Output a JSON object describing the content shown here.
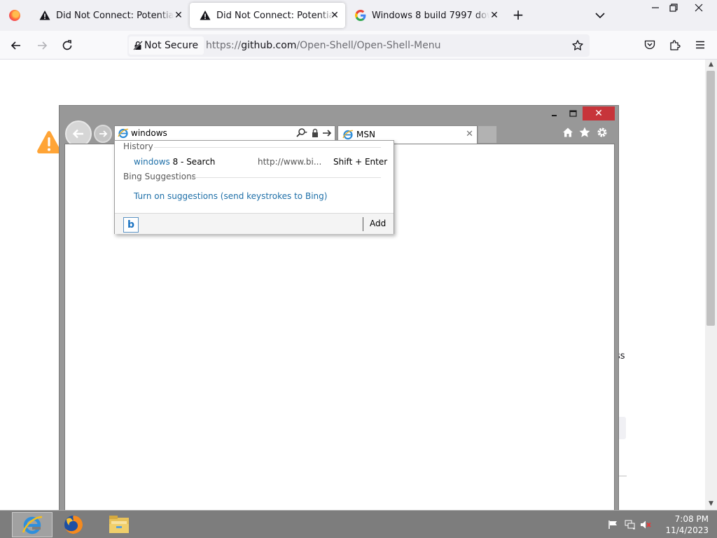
{
  "browser": {
    "tabs": [
      {
        "title": "Did Not Connect: Potential Security Issue",
        "icon": "warning-icon",
        "active": false
      },
      {
        "title": "Did Not Connect: Potential Security Issue",
        "icon": "warning-icon",
        "active": true
      },
      {
        "title": "Windows 8 build 7997 download",
        "icon": "google-icon",
        "active": false
      }
    ],
    "new_tab_label": "+",
    "close_glyph": "✕",
    "window_controls": [
      "minimize-icon",
      "restore-icon",
      "close-icon"
    ]
  },
  "navbar": {
    "security_label": "Not Secure",
    "url_prefix": "https://",
    "url_host": "github.com",
    "url_path": "/Open-Shell/Open-Shell-Menu",
    "icons": [
      "back-icon",
      "forward-icon",
      "reload-icon",
      "bookmark-star-icon",
      "pocket-icon",
      "extensions-icon",
      "menu-icon"
    ]
  },
  "page": {
    "bg_snippet": "ss"
  },
  "ie": {
    "address_text": "windows",
    "tab_title": "MSN",
    "close_glyph": "✕",
    "dropdown": {
      "history_label": "History",
      "history_item": {
        "highlight": "windows",
        "rest": " 8 - Search",
        "url": "http://www.bi...",
        "shortcut": "Shift + Enter"
      },
      "suggestions_label": "Bing Suggestions",
      "suggestions_link": "Turn on suggestions (send keystrokes to Bing)",
      "add_label": "Add",
      "bing_glyph": "b"
    }
  },
  "taskbar": {
    "apps": [
      "internet-explorer-icon",
      "firefox-icon",
      "file-explorer-icon"
    ],
    "time": "7:08 PM",
    "date": "11/4/2023"
  },
  "colors": {
    "ie_link": "#1e6fa8",
    "ie_close": "#c7343a",
    "warning": "#ffa436",
    "taskbar": "#7d7d7d"
  }
}
